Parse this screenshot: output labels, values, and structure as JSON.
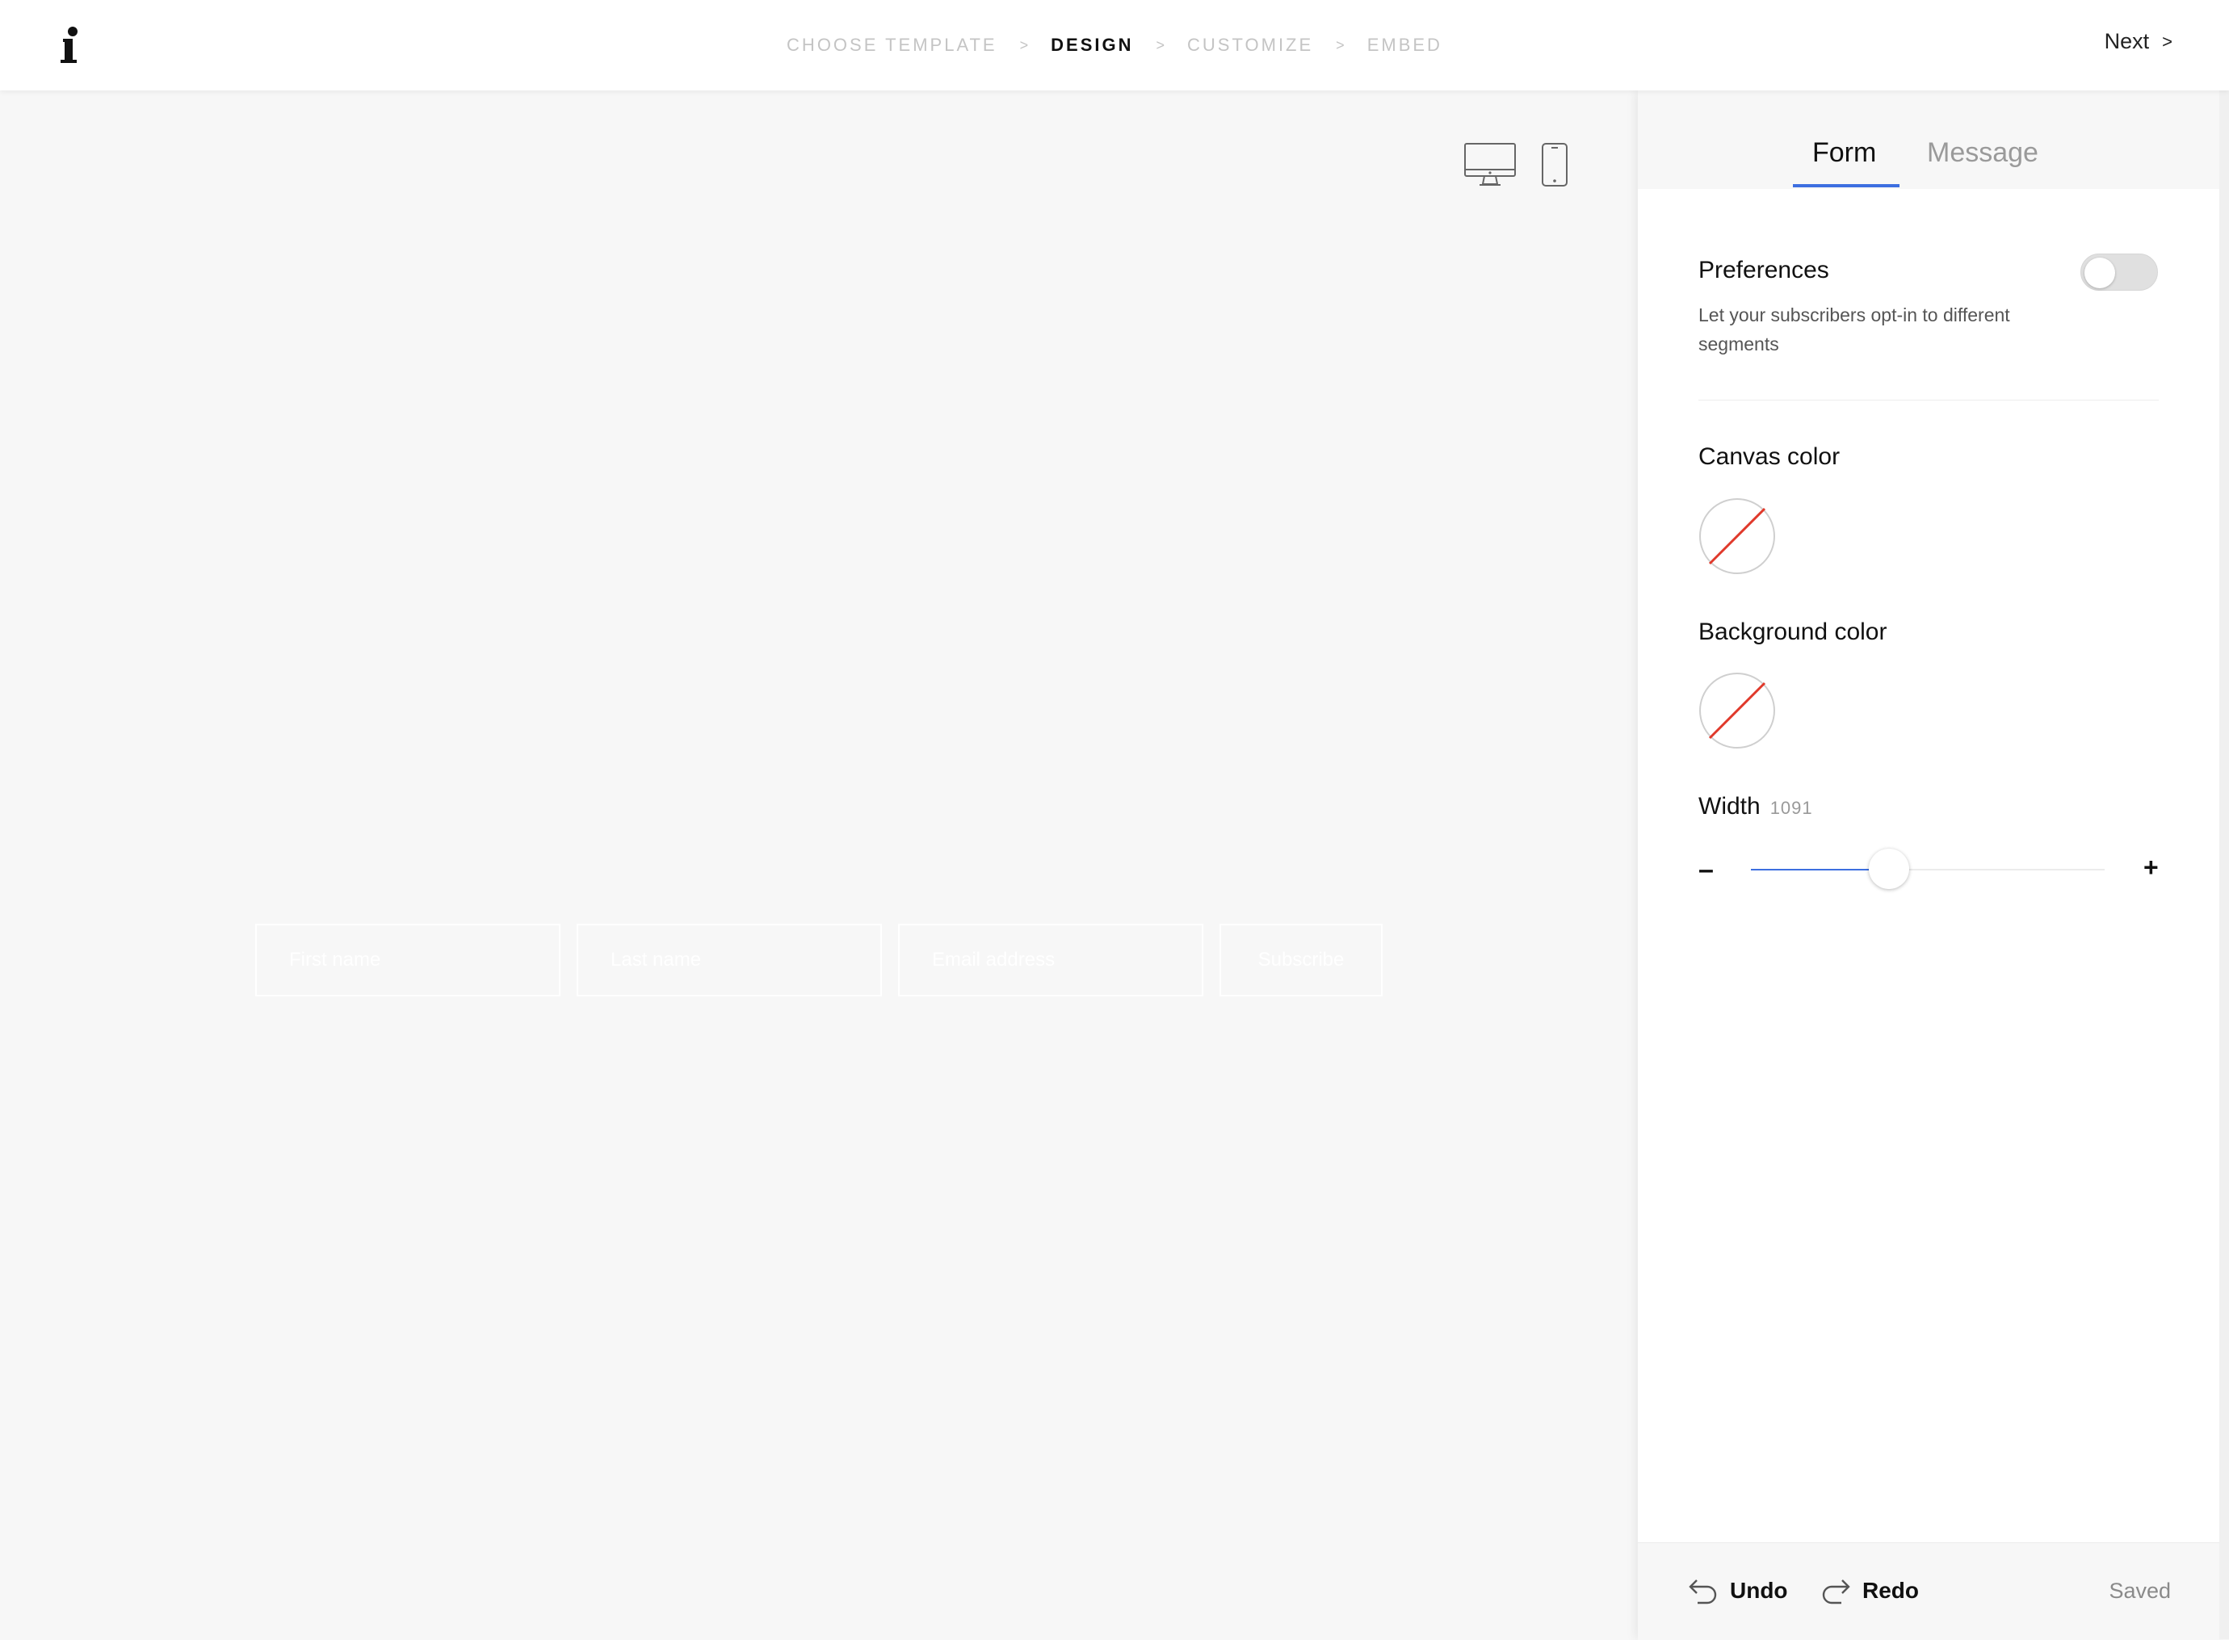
{
  "header": {
    "steps": [
      {
        "label": "CHOOSE TEMPLATE",
        "active": false
      },
      {
        "label": "DESIGN",
        "active": true
      },
      {
        "label": "CUSTOMIZE",
        "active": false
      },
      {
        "label": "EMBED",
        "active": false
      }
    ],
    "separator": ">",
    "next_label": "Next",
    "next_chevron": ">"
  },
  "canvas": {
    "fields": {
      "first_name": "First name",
      "last_name": "Last name",
      "email": "Email address"
    },
    "subscribe_label": "Subscribe"
  },
  "panel": {
    "tabs": {
      "form": "Form",
      "message": "Message"
    },
    "active_tab": "Form",
    "preferences": {
      "title": "Preferences",
      "description": "Let your subscribers opt-in to different segments",
      "enabled": false
    },
    "canvas_color": {
      "label": "Canvas color",
      "value": "none"
    },
    "background_color": {
      "label": "Background color",
      "value": "none"
    },
    "width": {
      "label": "Width",
      "value": "1091",
      "slider_fraction": 0.39,
      "minus": "–",
      "plus": "+"
    },
    "footer": {
      "undo": "Undo",
      "redo": "Redo",
      "status": "Saved"
    }
  },
  "colors": {
    "accent": "#3d6fe0",
    "none_swatch_line": "#e0392b"
  }
}
